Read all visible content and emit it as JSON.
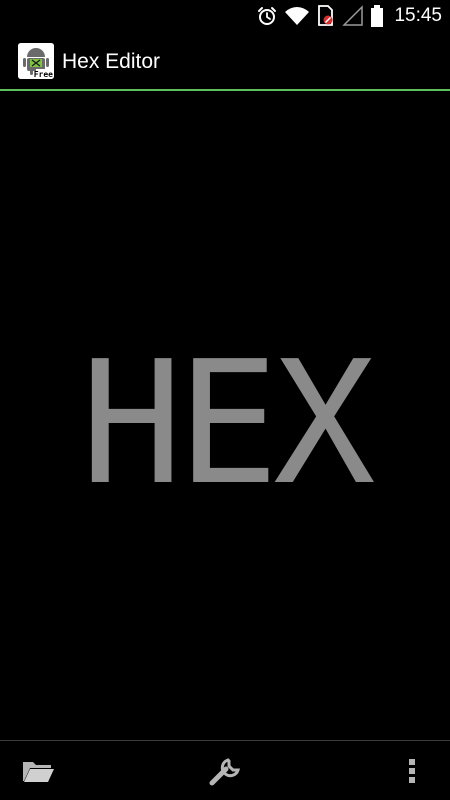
{
  "status_bar": {
    "time": "15:45",
    "icons": [
      "alarm-icon",
      "wifi-icon",
      "sim-blocked-icon",
      "signal-icon",
      "battery-icon"
    ]
  },
  "action_bar": {
    "title": "Hex Editor",
    "app_icon_badge": "Free",
    "accent_color": "#5fbf58"
  },
  "main": {
    "logo_text": "HEX",
    "logo_color": "#8a8a8a"
  },
  "toolbar": {
    "icons": [
      "folder-icon",
      "wrench-icon",
      "overflow-menu-icon"
    ]
  }
}
